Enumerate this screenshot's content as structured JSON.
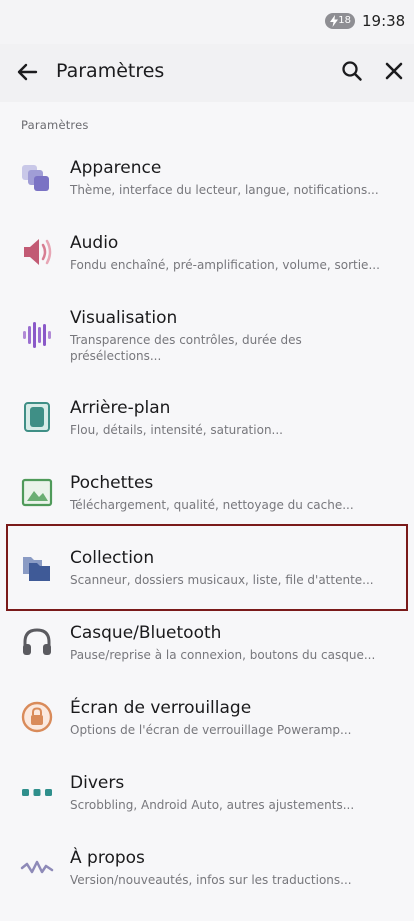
{
  "status": {
    "battery": "18",
    "time": "19:38"
  },
  "appbar": {
    "title": "Paramètres"
  },
  "section_label": "Paramètres",
  "items": [
    {
      "title": "Apparence",
      "subtitle": "Thème, interface du lecteur, langue, notifications...",
      "icon": "appearance-icon"
    },
    {
      "title": "Audio",
      "subtitle": "Fondu enchaîné, pré-amplification, volume, sortie...",
      "icon": "speaker-icon"
    },
    {
      "title": "Visualisation",
      "subtitle": "Transparence des contrôles, durée des présélections...",
      "icon": "waveform-icon"
    },
    {
      "title": "Arrière-plan",
      "subtitle": "Flou, détails, intensité, saturation...",
      "icon": "background-icon"
    },
    {
      "title": "Pochettes",
      "subtitle": "Téléchargement, qualité, nettoyage du cache...",
      "icon": "image-icon"
    },
    {
      "title": "Collection",
      "subtitle": "Scanneur, dossiers musicaux, liste, file d'attente...",
      "icon": "folder-icon"
    },
    {
      "title": "Casque/Bluetooth",
      "subtitle": "Pause/reprise à la connexion, boutons du casque...",
      "icon": "headphones-icon"
    },
    {
      "title": "Écran de verrouillage",
      "subtitle": "Options de l'écran de verrouillage Poweramp...",
      "icon": "lock-icon"
    },
    {
      "title": "Divers",
      "subtitle": "Scrobbling, Android Auto, autres ajustements...",
      "icon": "dots-icon"
    },
    {
      "title": "À propos",
      "subtitle": "Version/nouveautés, infos sur les traductions...",
      "icon": "zigzag-icon"
    }
  ]
}
